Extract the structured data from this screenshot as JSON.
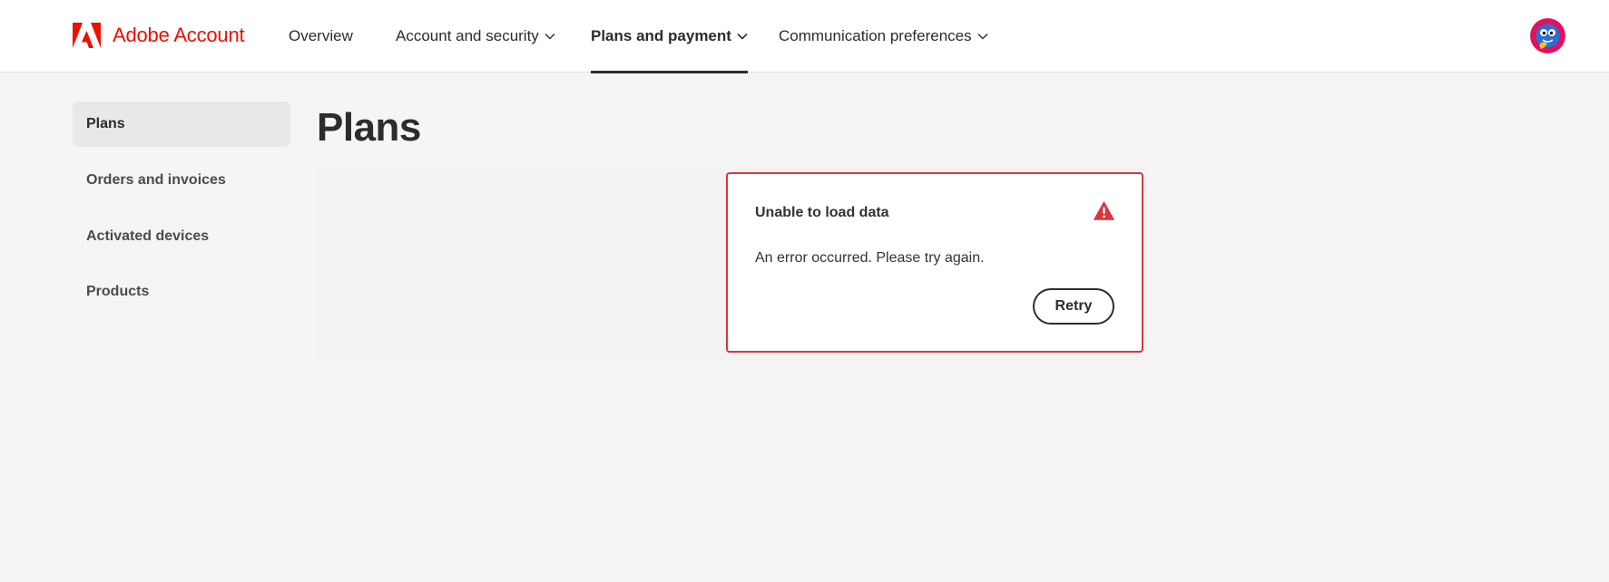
{
  "header": {
    "brand": "Adobe Account",
    "nav": [
      {
        "label": "Overview",
        "has_dropdown": false,
        "active": false
      },
      {
        "label": "Account and security",
        "has_dropdown": true,
        "active": false
      },
      {
        "label": "Plans and payment",
        "has_dropdown": true,
        "active": true
      },
      {
        "label": "Communication preferences",
        "has_dropdown": true,
        "active": false
      }
    ]
  },
  "sidebar": {
    "items": [
      {
        "label": "Plans",
        "selected": true
      },
      {
        "label": "Orders and invoices",
        "selected": false
      },
      {
        "label": "Activated devices",
        "selected": false
      },
      {
        "label": "Products",
        "selected": false
      }
    ]
  },
  "main": {
    "title": "Plans",
    "error": {
      "title": "Unable to load data",
      "message": "An error occurred. Please try again.",
      "retry_label": "Retry",
      "icon": "alert-triangle-icon"
    }
  },
  "colors": {
    "brand_red": "#eb1000",
    "error_red": "#d7373f",
    "background": "#f5f5f5",
    "text": "#2c2c2c"
  }
}
